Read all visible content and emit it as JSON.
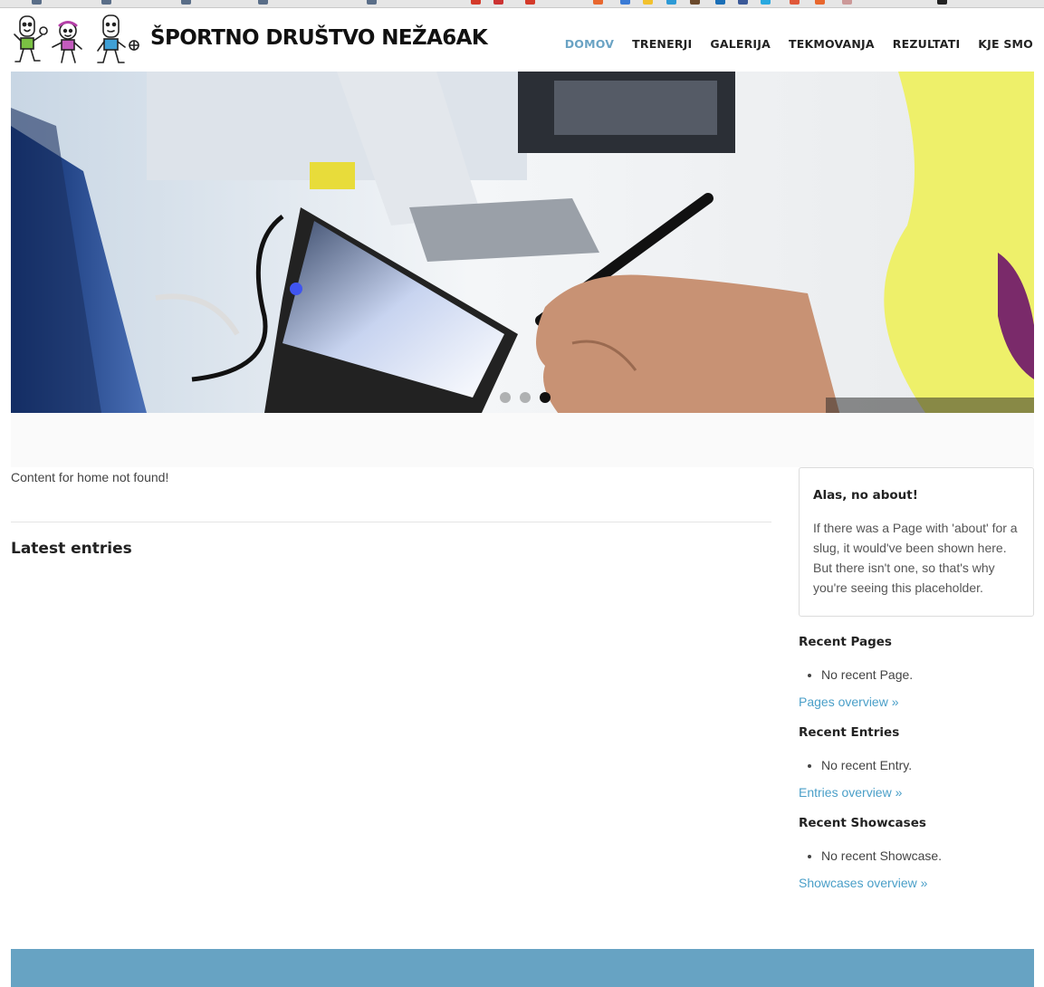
{
  "site": {
    "title": "ŠPORTNO DRUŠTVO NEŽA6AK"
  },
  "nav": {
    "items": [
      {
        "label": "DOMOV",
        "active": true
      },
      {
        "label": "TRENERJI",
        "active": false
      },
      {
        "label": "GALERIJA",
        "active": false
      },
      {
        "label": "TEKMOVANJA",
        "active": false
      },
      {
        "label": "REZULTATI",
        "active": false
      },
      {
        "label": "KJE SMO",
        "active": false
      }
    ]
  },
  "hero": {
    "slides": 3,
    "active_slide": 3
  },
  "main": {
    "notice": "Content for home not found!",
    "latest_title": "Latest entries"
  },
  "sidebar": {
    "about": {
      "title": "Alas, no about!",
      "text": "If there was a Page with 'about' for a slug, it would've been shown here. But there isn't one, so that's why you're seeing this placeholder."
    },
    "pages": {
      "title": "Recent Pages",
      "empty": "No recent Page.",
      "link": "Pages overview »"
    },
    "entries": {
      "title": "Recent Entries",
      "empty": "No recent Entry.",
      "link": "Entries overview »"
    },
    "showcases": {
      "title": "Recent Showcases",
      "empty": "No recent Showcase.",
      "link": "Showcases overview »"
    }
  },
  "colors": {
    "accent": "#6aa3c4",
    "link": "#4a9fc8",
    "footer": "#67a3c3"
  }
}
